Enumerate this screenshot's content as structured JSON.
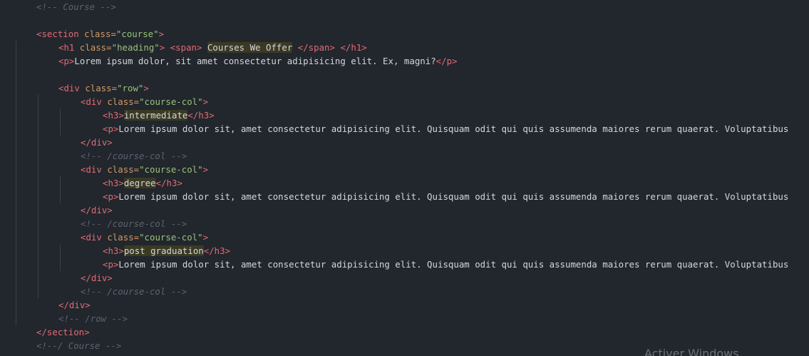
{
  "colors": {
    "background": "#22262d",
    "tag": "#e06c75",
    "attribute": "#d19a66",
    "string": "#98c379",
    "text": "#d4d7dd",
    "comment": "#5c6370",
    "highlight": "#3a3a23"
  },
  "lines": [
    {
      "indent": 1,
      "tokens": [
        {
          "t": "comment",
          "v": "<!-- Course -->"
        }
      ]
    },
    {
      "indent": 0,
      "tokens": []
    },
    {
      "indent": 1,
      "tokens": [
        {
          "t": "tag",
          "v": "<section "
        },
        {
          "t": "attr",
          "v": "class="
        },
        {
          "t": "str",
          "v": "\"course\""
        },
        {
          "t": "tag",
          "v": ">"
        }
      ]
    },
    {
      "indent": 2,
      "tokens": [
        {
          "t": "tag",
          "v": "<h1 "
        },
        {
          "t": "attr",
          "v": "class="
        },
        {
          "t": "str",
          "v": "\"heading\""
        },
        {
          "t": "tag",
          "v": ">"
        },
        {
          "t": "text",
          "v": " "
        },
        {
          "t": "tag",
          "v": "<span>"
        },
        {
          "t": "text",
          "v": " "
        },
        {
          "t": "hl",
          "v": "Courses We Offer"
        },
        {
          "t": "text",
          "v": " "
        },
        {
          "t": "tag",
          "v": "</span>"
        },
        {
          "t": "text",
          "v": " "
        },
        {
          "t": "tag",
          "v": "</h1>"
        }
      ]
    },
    {
      "indent": 2,
      "tokens": [
        {
          "t": "tag",
          "v": "<p>"
        },
        {
          "t": "text",
          "v": "Lorem ipsum dolor, sit amet consectetur adipisicing elit. Ex, magni?"
        },
        {
          "t": "tag",
          "v": "</p>"
        }
      ]
    },
    {
      "indent": 0,
      "tokens": []
    },
    {
      "indent": 2,
      "tokens": [
        {
          "t": "tag",
          "v": "<div "
        },
        {
          "t": "attr",
          "v": "class="
        },
        {
          "t": "str",
          "v": "\"row\""
        },
        {
          "t": "tag",
          "v": ">"
        }
      ]
    },
    {
      "indent": 3,
      "tokens": [
        {
          "t": "tag",
          "v": "<div "
        },
        {
          "t": "attr",
          "v": "class="
        },
        {
          "t": "str",
          "v": "\"course-col\""
        },
        {
          "t": "tag",
          "v": ">"
        }
      ]
    },
    {
      "indent": 4,
      "tokens": [
        {
          "t": "tag",
          "v": "<h3>"
        },
        {
          "t": "hl",
          "v": "intermediate"
        },
        {
          "t": "tag",
          "v": "</h3>"
        }
      ]
    },
    {
      "indent": 4,
      "tokens": [
        {
          "t": "tag",
          "v": "<p>"
        },
        {
          "t": "text",
          "v": "Lorem ipsum dolor sit, amet consectetur adipisicing elit. Quisquam odit qui quis assumenda maiores rerum quaerat. Voluptatibus"
        }
      ]
    },
    {
      "indent": 3,
      "tokens": [
        {
          "t": "tag",
          "v": "</div>"
        }
      ]
    },
    {
      "indent": 3,
      "tokens": [
        {
          "t": "comment",
          "v": "<!-- /course-col -->"
        }
      ]
    },
    {
      "indent": 3,
      "tokens": [
        {
          "t": "tag",
          "v": "<div "
        },
        {
          "t": "attr",
          "v": "class="
        },
        {
          "t": "str",
          "v": "\"course-col\""
        },
        {
          "t": "tag",
          "v": ">"
        }
      ]
    },
    {
      "indent": 4,
      "tokens": [
        {
          "t": "tag",
          "v": "<h3>"
        },
        {
          "t": "hl",
          "v": "degree"
        },
        {
          "t": "tag",
          "v": "</h3>"
        }
      ]
    },
    {
      "indent": 4,
      "tokens": [
        {
          "t": "tag",
          "v": "<p>"
        },
        {
          "t": "text",
          "v": "Lorem ipsum dolor sit, amet consectetur adipisicing elit. Quisquam odit qui quis assumenda maiores rerum quaerat. Voluptatibus"
        }
      ]
    },
    {
      "indent": 3,
      "tokens": [
        {
          "t": "tag",
          "v": "</div>"
        }
      ]
    },
    {
      "indent": 3,
      "tokens": [
        {
          "t": "comment",
          "v": "<!-- /course-col -->"
        }
      ]
    },
    {
      "indent": 3,
      "tokens": [
        {
          "t": "tag",
          "v": "<div "
        },
        {
          "t": "attr",
          "v": "class="
        },
        {
          "t": "str",
          "v": "\"course-col\""
        },
        {
          "t": "tag",
          "v": ">"
        }
      ]
    },
    {
      "indent": 4,
      "tokens": [
        {
          "t": "tag",
          "v": "<h3>"
        },
        {
          "t": "hl",
          "v": "post graduation"
        },
        {
          "t": "tag",
          "v": "</h3>"
        }
      ]
    },
    {
      "indent": 4,
      "tokens": [
        {
          "t": "tag",
          "v": "<p>"
        },
        {
          "t": "text",
          "v": "Lorem ipsum dolor sit, amet consectetur adipisicing elit. Quisquam odit qui quis assumenda maiores rerum quaerat. Voluptatibus"
        }
      ]
    },
    {
      "indent": 3,
      "tokens": [
        {
          "t": "tag",
          "v": "</div>"
        }
      ]
    },
    {
      "indent": 3,
      "tokens": [
        {
          "t": "comment",
          "v": "<!-- /course-col -->"
        }
      ]
    },
    {
      "indent": 2,
      "tokens": [
        {
          "t": "tag",
          "v": "</div>"
        }
      ]
    },
    {
      "indent": 2,
      "tokens": [
        {
          "t": "comment",
          "v": "<!-- /row -->"
        }
      ]
    },
    {
      "indent": 1,
      "tokens": [
        {
          "t": "tag",
          "v": "</section>"
        }
      ]
    },
    {
      "indent": 1,
      "tokens": [
        {
          "t": "comment",
          "v": "<!--/ Course -->"
        }
      ]
    }
  ],
  "watermark": "Activer Windows"
}
